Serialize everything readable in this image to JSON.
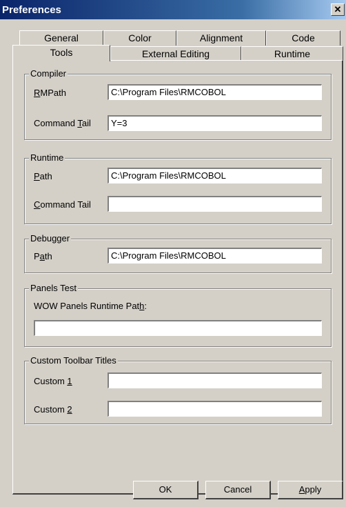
{
  "window": {
    "title": "Preferences",
    "close_glyph": "✕"
  },
  "tabs_top": [
    "General",
    "Color",
    "Alignment",
    "Code"
  ],
  "tabs_front": [
    "Tools",
    "External Editing",
    "Runtime"
  ],
  "compiler": {
    "legend": "Compiler",
    "rmpath_label": "RMPath",
    "rmpath_value": "C:\\Program Files\\RMCOBOL",
    "cmdtail_label": "Command Tail",
    "cmdtail_value": "Y=3"
  },
  "runtime": {
    "legend": "Runtime",
    "path_label": "Path",
    "path_value": "C:\\Program Files\\RMCOBOL",
    "cmdtail_label": "Command Tail",
    "cmdtail_value": ""
  },
  "debugger": {
    "legend": "Debugger",
    "path_label": "Path",
    "path_value": "C:\\Program Files\\RMCOBOL"
  },
  "panels": {
    "legend": "Panels Test",
    "label": "WOW Panels Runtime Path:",
    "value": ""
  },
  "toolbar": {
    "legend": "Custom Toolbar Titles",
    "custom1_label": "Custom 1",
    "custom1_value": "",
    "custom2_label": "Custom 2",
    "custom2_value": ""
  },
  "buttons": {
    "ok": "OK",
    "cancel": "Cancel",
    "apply": "Apply"
  }
}
